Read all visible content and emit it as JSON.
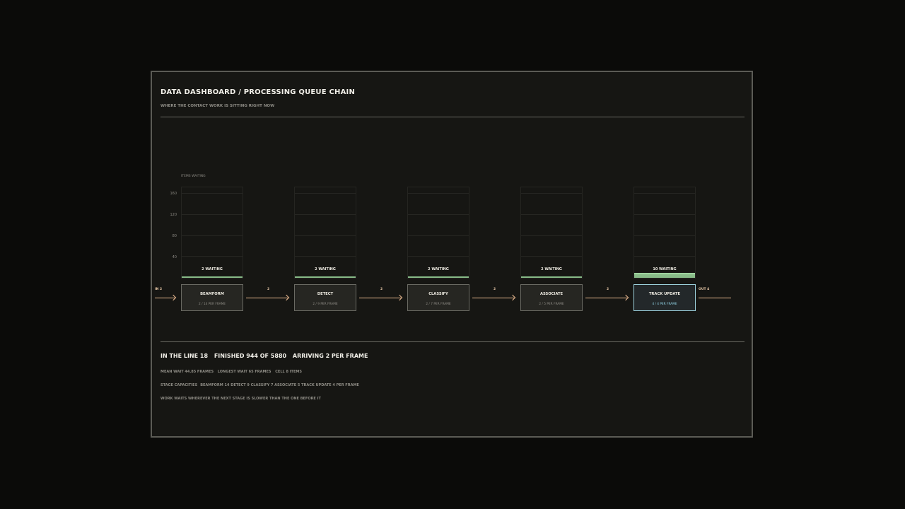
{
  "header": {
    "title": "DATA DASHBOARD / PROCESSING QUEUE CHAIN",
    "subtitle": "WHERE THE CONTACT WORK IS SITTING RIGHT NOW"
  },
  "chart_data": {
    "type": "bar",
    "ylabel": "ITEMS WAITING",
    "ylim": [
      0,
      175
    ],
    "yticks": [
      "160",
      "120",
      "80",
      "40"
    ],
    "categories": [
      "BEAMFORM",
      "DETECT",
      "CLASSIFY",
      "ASSOCIATE",
      "TRACK UPDATE"
    ],
    "values": [
      2,
      2,
      2,
      2,
      10
    ],
    "value_labels": [
      "2 WAITING",
      "2 WAITING",
      "2 WAITING",
      "2 WAITING",
      "10 WAITING"
    ],
    "bar_color": "#88bb88"
  },
  "stages": [
    {
      "name": "BEAMFORM",
      "rate": "2 / 14 PER FRAME"
    },
    {
      "name": "DETECT",
      "rate": "2 / 9 PER FRAME"
    },
    {
      "name": "CLASSIFY",
      "rate": "2 / 7 PER FRAME"
    },
    {
      "name": "ASSOCIATE",
      "rate": "2 / 5 PER FRAME"
    },
    {
      "name": "TRACK UPDATE",
      "rate": "4 / 4 PER FRAME"
    }
  ],
  "flow": {
    "in": "IN 2",
    "between": [
      "2",
      "2",
      "2",
      "2"
    ],
    "out": "OUT 4",
    "arrow_color": "#e9b98f",
    "active_color": "#9cd0dc"
  },
  "summary": {
    "in_line": "IN THE LINE  18",
    "finished": "FINISHED  944 OF 5880",
    "arriving": "ARRIVING  2 PER FRAME"
  },
  "stats": {
    "mean_wait": "MEAN WAIT 44.85 FRAMES",
    "longest_wait": "LONGEST WAIT 65 FRAMES",
    "cell": "CELL 8 ITEMS",
    "capacities_label": "STAGE CAPACITIES",
    "capacities": "BEAMFORM 14  DETECT 9  CLASSIFY 7  ASSOCIATE 5  TRACK UPDATE 4 PER FRAME",
    "footer": "WORK WAITS WHEREVER THE NEXT STAGE IS SLOWER THAN THE ONE BEFORE IT"
  }
}
